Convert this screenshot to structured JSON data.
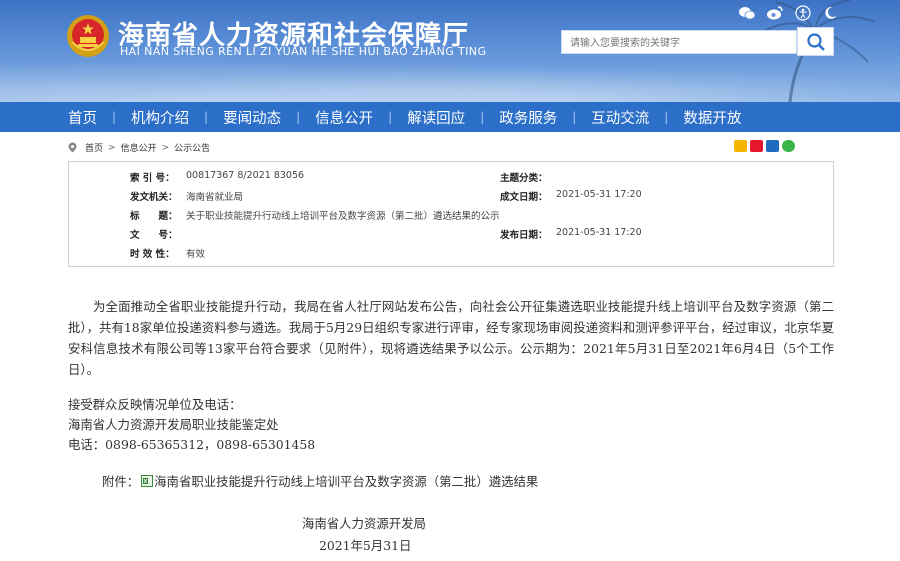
{
  "header": {
    "title": "海南省人力资源和社会保障厅",
    "subtitle": "HAI NAN SHENG REN LI ZI YUAN HE SHE HUI BAO ZHANG TING",
    "top_icons": [
      "wechat-icon",
      "weibo-icon",
      "accessibility-icon",
      "night-mode-icon"
    ],
    "search_placeholder": "请输入您要搜索的关键字"
  },
  "nav": {
    "items": [
      "首页",
      "机构介绍",
      "要闻动态",
      "信息公开",
      "解读回应",
      "政务服务",
      "互动交流",
      "数据开放"
    ]
  },
  "breadcrumb": [
    "首页",
    "信息公开",
    "公示公告"
  ],
  "info": {
    "index_label": "索 引 号：",
    "index_value": "00817367 8/2021 83056",
    "topic_label": "主题分类：",
    "topic_value": "",
    "issuer_label": "发文机关：",
    "issuer_value": "海南省就业局",
    "created_label": "成文日期：",
    "created_value": "2021-05-31 17:20",
    "title_label": "标　　题：",
    "title_value": "关于职业技能提升行动线上培训平台及数字资源（第二批）遴选结果的公示",
    "docno_label": "文　　号：",
    "docno_value": "",
    "published_label": "发布日期：",
    "published_value": "2021-05-31 17:20",
    "validity_label": "时 效 性：",
    "validity_value": "有效"
  },
  "body": {
    "paragraph": "为全面推动全省职业技能提升行动，我局在省人社厅网站发布公告，向社会公开征集遴选职业技能提升线上培训平台及数字资源（第二批），共有18家单位投递资料参与遴选。我局于5月29日组织专家进行评审，经专家现场审阅投递资料和测评参评平台，经过审议，北京华夏安科信息技术有限公司等13家平台符合要求（见附件），现将遴选结果予以公示。公示期为：2021年5月31日至2021年6月4日（5个工作日）。",
    "contact_line1": "接受群众反映情况单位及电话：",
    "contact_line2": "海南省人力资源开发局职业技能鉴定处",
    "contact_line3": "电话：0898-65365312，0898-65301458",
    "attachment_label": "附件：",
    "attachment_link": "海南省职业技能提升行动线上培训平台及数字资源（第二批）遴选结果",
    "sign_org": "海南省人力资源开发局",
    "sign_date": "2021年5月31日"
  },
  "colors": {
    "nav_bg": "#2c6fc9",
    "header_top": "#3d72c4",
    "header_bottom": "#8fb6e6"
  }
}
